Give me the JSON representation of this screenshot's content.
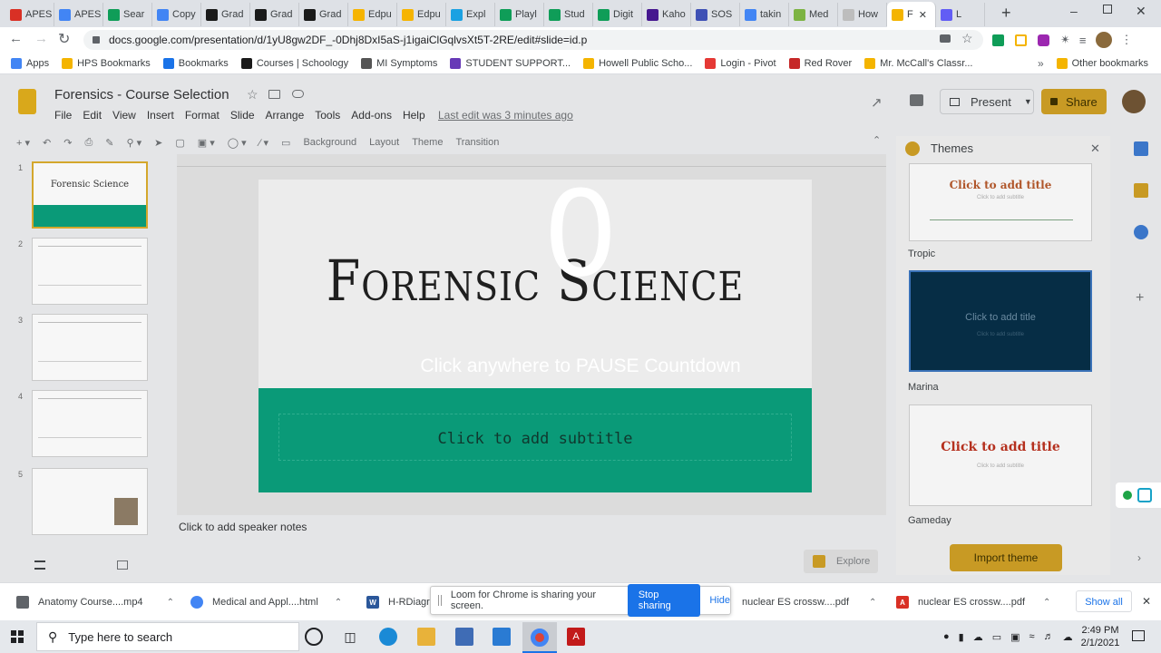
{
  "browser": {
    "tabs": [
      {
        "label": "APES",
        "icon": "gmail-icon",
        "color": "#d93025"
      },
      {
        "label": "APES",
        "icon": "docs-icon",
        "color": "#4285f4"
      },
      {
        "label": "Sear",
        "icon": "drive-icon",
        "color": "#0f9d58"
      },
      {
        "label": "Copy",
        "icon": "docs-icon",
        "color": "#4285f4"
      },
      {
        "label": "Grad",
        "icon": "schoology-icon",
        "color": "#1a1a1a"
      },
      {
        "label": "Grad",
        "icon": "schoology-icon",
        "color": "#1a1a1a"
      },
      {
        "label": "Grad",
        "icon": "schoology-icon",
        "color": "#1a1a1a"
      },
      {
        "label": "Edpu",
        "icon": "edpuzzle-icon",
        "color": "#f6b400"
      },
      {
        "label": "Edpu",
        "icon": "edpuzzle-icon",
        "color": "#f6b400"
      },
      {
        "label": "Expl",
        "icon": "explain-icon",
        "color": "#1ba1e2"
      },
      {
        "label": "Playl",
        "icon": "sheets-icon",
        "color": "#0f9d58"
      },
      {
        "label": "Stud",
        "icon": "sheets-icon",
        "color": "#0f9d58"
      },
      {
        "label": "Digit",
        "icon": "sheets-icon",
        "color": "#0f9d58"
      },
      {
        "label": "Kaho",
        "icon": "kahoot-icon",
        "color": "#46178f"
      },
      {
        "label": "SOS",
        "icon": "sos-icon",
        "color": "#3f51b5"
      },
      {
        "label": "takin",
        "icon": "google-icon",
        "color": "#4285f4"
      },
      {
        "label": "Med",
        "icon": "med-icon",
        "color": "#7cb342"
      },
      {
        "label": "How",
        "icon": "how-icon",
        "color": "#bdbdbd"
      },
      {
        "label": "F",
        "icon": "slides-icon",
        "color": "#f4b400"
      },
      {
        "label": "L",
        "icon": "loom-icon",
        "color": "#625df5"
      }
    ],
    "address": "docs.google.com/presentation/d/1yU8gw2DF_-0Dhj8DxI5aS-j1igaiClGqlvsXt5T-2RE/edit#slide=id.p",
    "bookmarks": [
      {
        "label": "Apps",
        "color": "#4285f4"
      },
      {
        "label": "HPS Bookmarks",
        "color": "#f4b400"
      },
      {
        "label": "Bookmarks",
        "color": "#1a73e8"
      },
      {
        "label": "Courses | Schoology",
        "color": "#1a1a1a"
      },
      {
        "label": "MI Symptoms",
        "color": "#555555"
      },
      {
        "label": "STUDENT SUPPORT...",
        "color": "#673ab7"
      },
      {
        "label": "Howell Public Scho...",
        "color": "#f4b400"
      },
      {
        "label": "Login - Pivot",
        "color": "#e53935"
      },
      {
        "label": "Red Rover",
        "color": "#c62828"
      },
      {
        "label": "Mr. McCall's Classr...",
        "color": "#f4b400"
      }
    ],
    "other_bookmarks": "Other bookmarks"
  },
  "slides": {
    "doc_title": "Forensics - Course Selection",
    "menu": [
      "File",
      "Edit",
      "View",
      "Insert",
      "Format",
      "Slide",
      "Arrange",
      "Tools",
      "Add-ons",
      "Help"
    ],
    "last_edit": "Last edit was 3 minutes ago",
    "present_label": "Present",
    "share_label": "Share",
    "toolbar": {
      "background": "Background",
      "layout": "Layout",
      "theme": "Theme",
      "transition": "Transition"
    },
    "slide_title": "Forensic Science",
    "slide_subtitle": "Click to add subtitle",
    "speaker_notes": "Click to add speaker notes",
    "explore_label": "Explore",
    "thumb_title": "Forensic Science",
    "slide_numbers": [
      "1",
      "2",
      "3",
      "4",
      "5"
    ],
    "themes_panel": {
      "title": "Themes",
      "cards": [
        {
          "name": "Tropic",
          "title": "Click to add title",
          "subtitle": "Click to add subtitle"
        },
        {
          "name": "Marina",
          "title": "Click to add title",
          "subtitle": "Click to add subtitle"
        },
        {
          "name": "Gameday",
          "title": "Click to add title",
          "subtitle": "Click to add subtitle"
        }
      ],
      "import_label": "Import theme"
    }
  },
  "overlay": {
    "countdown": "0",
    "message": "Click anywhere to PAUSE Countdown"
  },
  "downloads": {
    "items": [
      {
        "label": "Anatomy Course....mp4",
        "color": "#5f6368"
      },
      {
        "label": "Medical and Appl....html",
        "color": "#4285f4"
      },
      {
        "label": "H-RDiagr",
        "color": "#2b579a"
      },
      {
        "label": "nuclear ES crossw....pdf",
        "color": "#d93025"
      },
      {
        "label": "nuclear ES crossw....pdf",
        "color": "#d93025"
      }
    ],
    "show_all": "Show all"
  },
  "loom": {
    "message": "Loom for Chrome is sharing your screen.",
    "stop_label": "Stop sharing",
    "hide_label": "Hide"
  },
  "taskbar": {
    "search_placeholder": "Type here to search",
    "time": "2:49 PM",
    "date": "2/1/2021"
  },
  "colors": {
    "accent": "#1a73e8",
    "slide_teal": "#0a9a78",
    "share_yellow": "#fbbc04"
  }
}
